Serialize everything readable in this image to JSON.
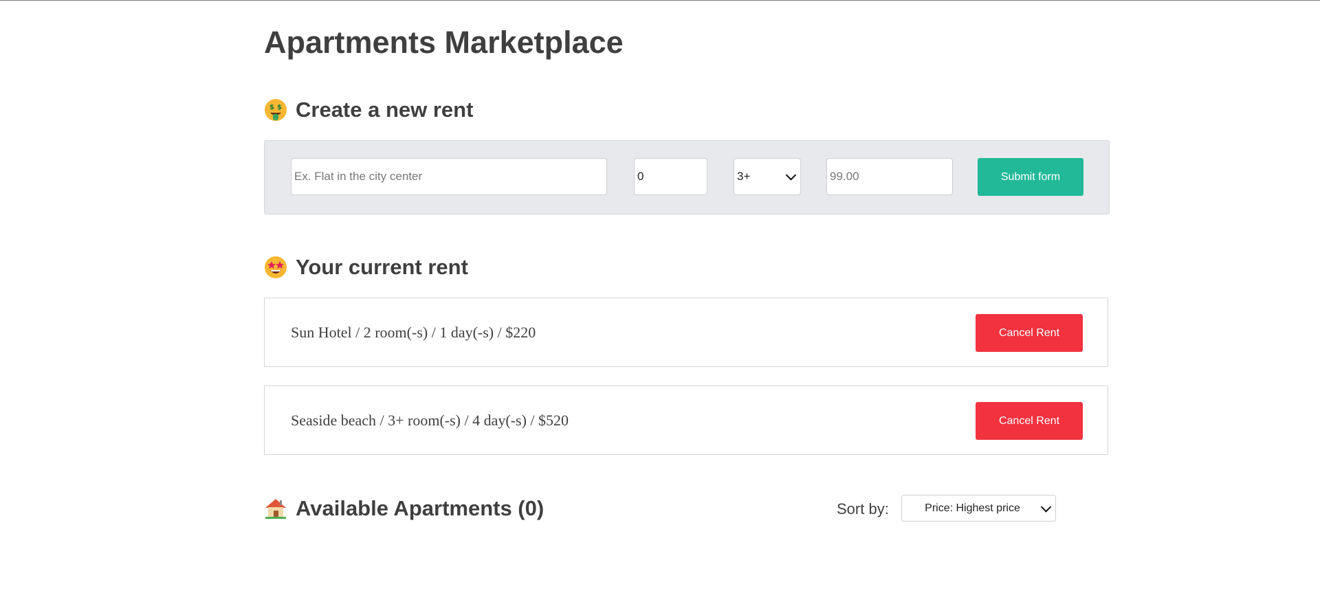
{
  "page": {
    "title": "Apartments Marketplace"
  },
  "create_rent": {
    "heading": "Create a new rent",
    "emoji": "money-mouth-face-icon",
    "name_placeholder": "Ex. Flat in the city center",
    "days_value": "0",
    "rooms_selected": "3+",
    "price_placeholder": "99.00",
    "submit_label": "Submit form"
  },
  "current_rent": {
    "heading": "Your current rent",
    "emoji": "star-struck-face-icon",
    "items": [
      {
        "text": "Sun Hotel / 2 room(-s) / 1 day(-s) / $220",
        "cancel_label": "Cancel Rent"
      },
      {
        "text": "Seaside beach / 3+ room(-s) / 4 day(-s) / $520",
        "cancel_label": "Cancel Rent"
      }
    ]
  },
  "available": {
    "heading": "Available Apartments (0)",
    "emoji": "house-icon",
    "sort_label": "Sort by:",
    "sort_selected": "Price: Highest price"
  },
  "colors": {
    "submit": "#22b998",
    "cancel": "#f2323f",
    "form_bg": "#e8e9ec",
    "text": "#3f3f3f"
  }
}
